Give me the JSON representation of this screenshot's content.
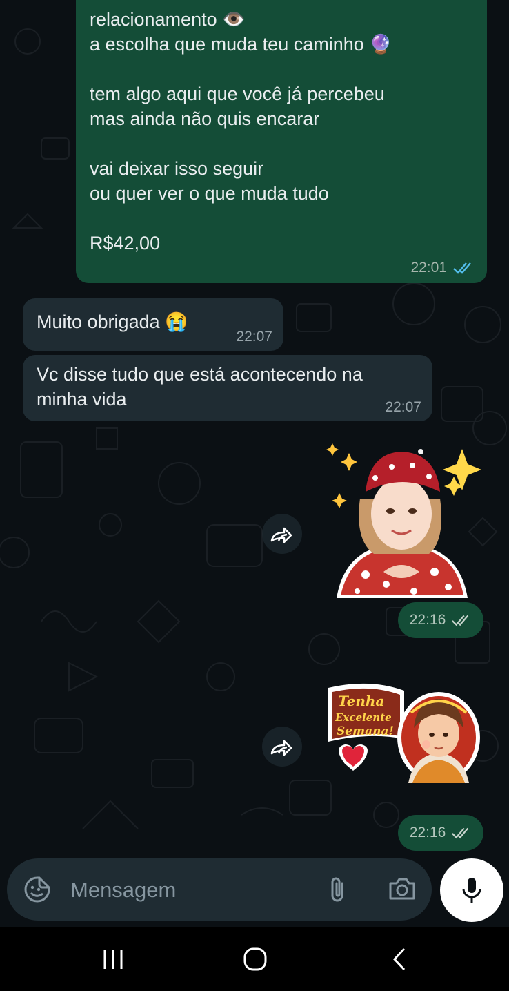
{
  "colors": {
    "background": "#0b1014",
    "outgoing_bubble": "#144d37",
    "incoming_bubble": "#1f2c33",
    "read_ticks": "#53bdeb",
    "text": "#e9edef"
  },
  "messages": [
    {
      "direction": "outgoing",
      "lines": [
        "relacionamento 👁️",
        "a escolha que muda teu caminho 🔮",
        "",
        "tem algo aqui que você já percebeu",
        "mas ainda não quis encarar",
        "",
        "vai deixar isso seguir",
        "ou quer ver o que muda tudo",
        "",
        "R$42,00"
      ],
      "time": "22:01",
      "status": "read"
    },
    {
      "direction": "incoming",
      "text": "Muito obrigada 😭",
      "time": "22:07"
    },
    {
      "direction": "incoming",
      "text": "Vc disse tudo que está acontecendo na\nminha vida",
      "time": "22:07"
    },
    {
      "direction": "outgoing",
      "type": "sticker",
      "sticker": "fortune-teller-woman-red-scarf",
      "time": "22:16",
      "status": "delivered"
    },
    {
      "direction": "outgoing",
      "type": "sticker",
      "sticker": "Tenha Excelente Semana!",
      "time": "22:16",
      "status": "delivered"
    }
  ],
  "composer": {
    "placeholder": "Mensagem",
    "icons": [
      "sticker-emoji-icon",
      "paperclip-icon",
      "camera-icon",
      "microphone-icon"
    ]
  },
  "navigation": {
    "icons": [
      "recent-apps-icon",
      "home-icon",
      "back-icon"
    ]
  }
}
